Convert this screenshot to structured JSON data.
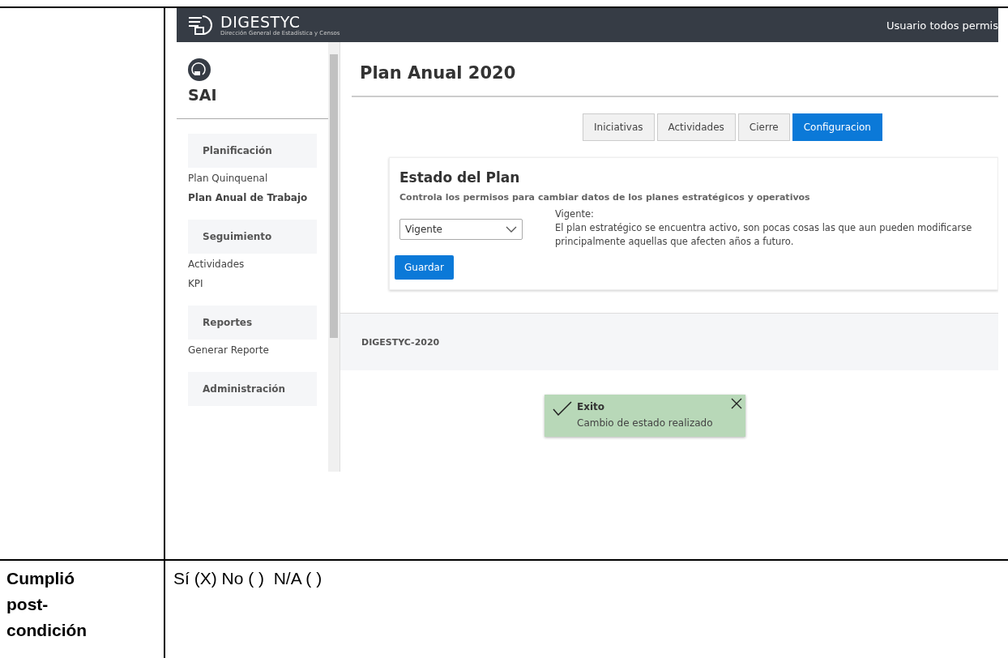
{
  "screenshot": {
    "header": {
      "logo_text": "DIGESTYC",
      "logo_subtitle": "Dirección General de Estadística y Censos",
      "user": "Usuario todos permis"
    },
    "sidebar": {
      "app_name": "SAI",
      "sections": [
        {
          "title": "Planificación",
          "items": [
            {
              "label": "Plan Quinquenal",
              "selected": false
            },
            {
              "label": "Plan Anual de Trabajo",
              "selected": true
            }
          ]
        },
        {
          "title": "Seguimiento",
          "items": [
            {
              "label": "Actividades",
              "selected": false
            },
            {
              "label": "KPI",
              "selected": false
            }
          ]
        },
        {
          "title": "Reportes",
          "items": [
            {
              "label": "Generar Reporte",
              "selected": false
            }
          ]
        },
        {
          "title": "Administración"
        }
      ]
    },
    "page_title": "Plan Anual 2020",
    "tabs": [
      {
        "label": "Iniciativas",
        "selected": false
      },
      {
        "label": "Actividades",
        "selected": false
      },
      {
        "label": "Cierre",
        "selected": false
      },
      {
        "label": "Configuracion",
        "selected": true
      }
    ],
    "card": {
      "title": "Estado del Plan",
      "subtitle": "Controla los permisos para cambiar datos de los planes estratégicos y operativos",
      "select_value": "Vigente",
      "desc_title": "Vigente:",
      "description": "El plan estratégico se encuentra activo, son pocas cosas las que aun pueden modificarse principalmente aquellas que afecten años a futuro.",
      "button": "Guardar"
    },
    "footer": "DIGESTYC-2020",
    "toast": {
      "title": "Exito",
      "message": "Cambio de estado realizado"
    }
  },
  "table": {
    "label": "Cumplió post-condición",
    "value": "Sí (X) No ( )  N/A ( )"
  }
}
